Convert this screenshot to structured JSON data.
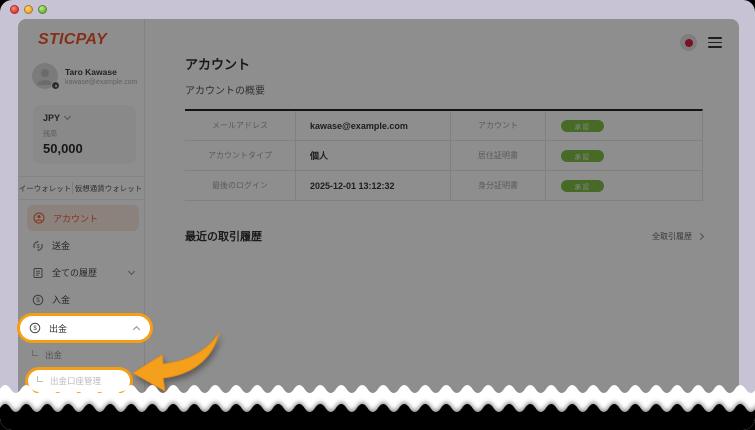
{
  "window": {
    "titlebar_buttons": [
      "close",
      "minimize",
      "zoom"
    ]
  },
  "sidebar": {
    "logo": "STICPAY",
    "user": {
      "name": "Taro Kawase",
      "email": "kawase@example.com"
    },
    "wallet": {
      "currency": "JPY",
      "balance_label": "残高",
      "balance": "50,000"
    },
    "wallet_tabs": [
      {
        "label": "イーウォレット"
      },
      {
        "label": "仮想通貨ウォレット"
      }
    ],
    "menu": [
      {
        "label": "アカウント",
        "icon": "user-circle-icon",
        "state": "active"
      },
      {
        "label": "送金",
        "icon": "transfer-icon"
      },
      {
        "label": "全ての履歴",
        "icon": "history-icon",
        "state": "collapsible"
      },
      {
        "label": "入金",
        "icon": "deposit-icon"
      },
      {
        "label": "出金",
        "icon": "withdraw-icon",
        "state": "expanded-highlighted"
      }
    ],
    "submenu": [
      {
        "label": "出金"
      },
      {
        "label": "出金口座管理",
        "state": "highlighted"
      }
    ]
  },
  "header": {
    "language_flag": "japan",
    "menu_icon": "hamburger"
  },
  "main": {
    "title": "アカウント",
    "subtitle": "アカウントの概要",
    "overview_table": {
      "rows": [
        {
          "label": "メールアドレス",
          "value": "kawase@example.com",
          "doc_label": "アカウント",
          "status": "承認"
        },
        {
          "label": "アカウントタイプ",
          "value": "個人",
          "doc_label": "居住証明書",
          "status": "承認"
        },
        {
          "label": "最後のログイン",
          "value": "2025-12-01 13:12:32",
          "doc_label": "身分証明書",
          "status": "承認"
        }
      ]
    },
    "recent": {
      "title": "最近の取引履歴",
      "link_label": "全取引履歴"
    }
  },
  "colors": {
    "brand": "#ee4d22",
    "highlight_ring": "#f49d15",
    "status_green": "#79bd3e",
    "frame": "#c7c3d4"
  }
}
